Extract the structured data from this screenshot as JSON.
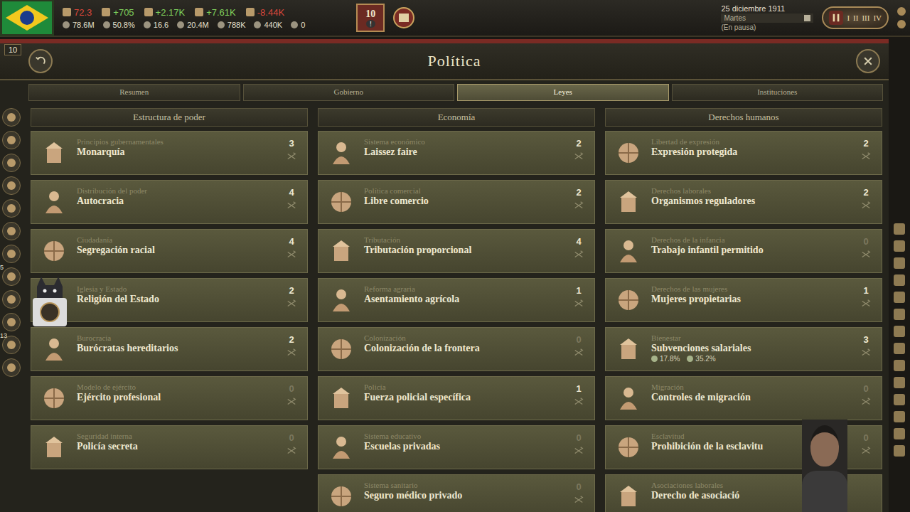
{
  "top_bar": {
    "resources": [
      {
        "value": "72.3",
        "color": "#d9473b"
      },
      {
        "value": "+705",
        "color": "#7fd15c"
      },
      {
        "value": "+2.17K",
        "color": "#7fd15c"
      },
      {
        "value": "+7.61K",
        "color": "#7fd15c"
      },
      {
        "value": "-8.44K",
        "color": "#d9473b"
      }
    ],
    "stats": [
      "78.6M",
      "50.8%",
      "16.6",
      "20.4M",
      "788K",
      "440K",
      "0"
    ],
    "alert_badge": "10",
    "alert_mark": "!",
    "date": "25 diciembre 1911",
    "weekday": "Martes",
    "status": "(En pausa)",
    "speeds": [
      "I",
      "II",
      "III",
      "IV"
    ],
    "paused": true
  },
  "side_badge": "10",
  "left_sidebar": {
    "items": [
      {
        "badge": null
      },
      {
        "badge": null
      },
      {
        "badge": null
      },
      {
        "badge": null
      },
      {
        "badge": null
      },
      {
        "badge": null
      },
      {
        "badge": null
      },
      {
        "badge": "5"
      },
      {
        "badge": null
      },
      {
        "badge": null
      },
      {
        "badge": "13"
      },
      {
        "badge": null
      }
    ]
  },
  "panel": {
    "title": "Política",
    "tabs": [
      {
        "label": "Resumen",
        "selected": false
      },
      {
        "label": "Gobierno",
        "selected": false
      },
      {
        "label": "Leyes",
        "selected": true
      },
      {
        "label": "Instituciones",
        "selected": false
      }
    ]
  },
  "columns": [
    {
      "title": "Estructura de poder",
      "laws": [
        {
          "category": "Principios gubernamentales",
          "name": "Monarquía",
          "count": "3",
          "dimmed": false,
          "stats": []
        },
        {
          "category": "Distribución del poder",
          "name": "Autocracia",
          "count": "4",
          "dimmed": false,
          "stats": []
        },
        {
          "category": "Ciudadanía",
          "name": "Segregación racial",
          "count": "4",
          "dimmed": false,
          "stats": []
        },
        {
          "category": "Iglesia y Estado",
          "name": "Religión del Estado",
          "count": "2",
          "dimmed": false,
          "stats": []
        },
        {
          "category": "Burocracia",
          "name": "Burócratas hereditarios",
          "count": "2",
          "dimmed": false,
          "stats": []
        },
        {
          "category": "Modelo de ejército",
          "name": "Ejército profesional",
          "count": "0",
          "dimmed": true,
          "stats": []
        },
        {
          "category": "Seguridad interna",
          "name": "Policía secreta",
          "count": "0",
          "dimmed": true,
          "stats": []
        }
      ]
    },
    {
      "title": "Economía",
      "laws": [
        {
          "category": "Sistema económico",
          "name": "Laissez faire",
          "count": "2",
          "dimmed": false,
          "stats": []
        },
        {
          "category": "Política comercial",
          "name": "Libre comercio",
          "count": "2",
          "dimmed": false,
          "stats": []
        },
        {
          "category": "Tributación",
          "name": "Tributación proporcional",
          "count": "4",
          "dimmed": false,
          "stats": []
        },
        {
          "category": "Reforma agraria",
          "name": "Asentamiento agrícola",
          "count": "1",
          "dimmed": false,
          "stats": []
        },
        {
          "category": "Colonización",
          "name": "Colonización de la frontera",
          "count": "0",
          "dimmed": true,
          "stats": []
        },
        {
          "category": "Policía",
          "name": "Fuerza policial específica",
          "count": "1",
          "dimmed": false,
          "stats": []
        },
        {
          "category": "Sistema educativo",
          "name": "Escuelas privadas",
          "count": "0",
          "dimmed": true,
          "stats": []
        },
        {
          "category": "Sistema sanitario",
          "name": "Seguro médico privado",
          "count": "0",
          "dimmed": true,
          "stats": []
        }
      ]
    },
    {
      "title": "Derechos humanos",
      "laws": [
        {
          "category": "Libertad de expresión",
          "name": "Expresión protegida",
          "count": "2",
          "dimmed": false,
          "stats": []
        },
        {
          "category": "Derechos laborales",
          "name": "Organismos reguladores",
          "count": "2",
          "dimmed": false,
          "stats": []
        },
        {
          "category": "Derechos de la infancia",
          "name": "Trabajo infantil permitido",
          "count": "0",
          "dimmed": true,
          "stats": []
        },
        {
          "category": "Derechos de las mujeres",
          "name": "Mujeres propietarias",
          "count": "1",
          "dimmed": false,
          "stats": []
        },
        {
          "category": "Bienestar",
          "name": "Subvenciones salariales",
          "count": "3",
          "dimmed": false,
          "stats": [
            "17.8%",
            "35.2%"
          ]
        },
        {
          "category": "Migración",
          "name": "Controles de migración",
          "count": "0",
          "dimmed": true,
          "stats": []
        },
        {
          "category": "Esclavitud",
          "name": "Prohibición de la esclavitu",
          "count": "0",
          "dimmed": true,
          "stats": []
        },
        {
          "category": "Asociaciones laborales",
          "name": "Derecho de asociació",
          "count": null,
          "dimmed": false,
          "stats": []
        }
      ]
    }
  ]
}
